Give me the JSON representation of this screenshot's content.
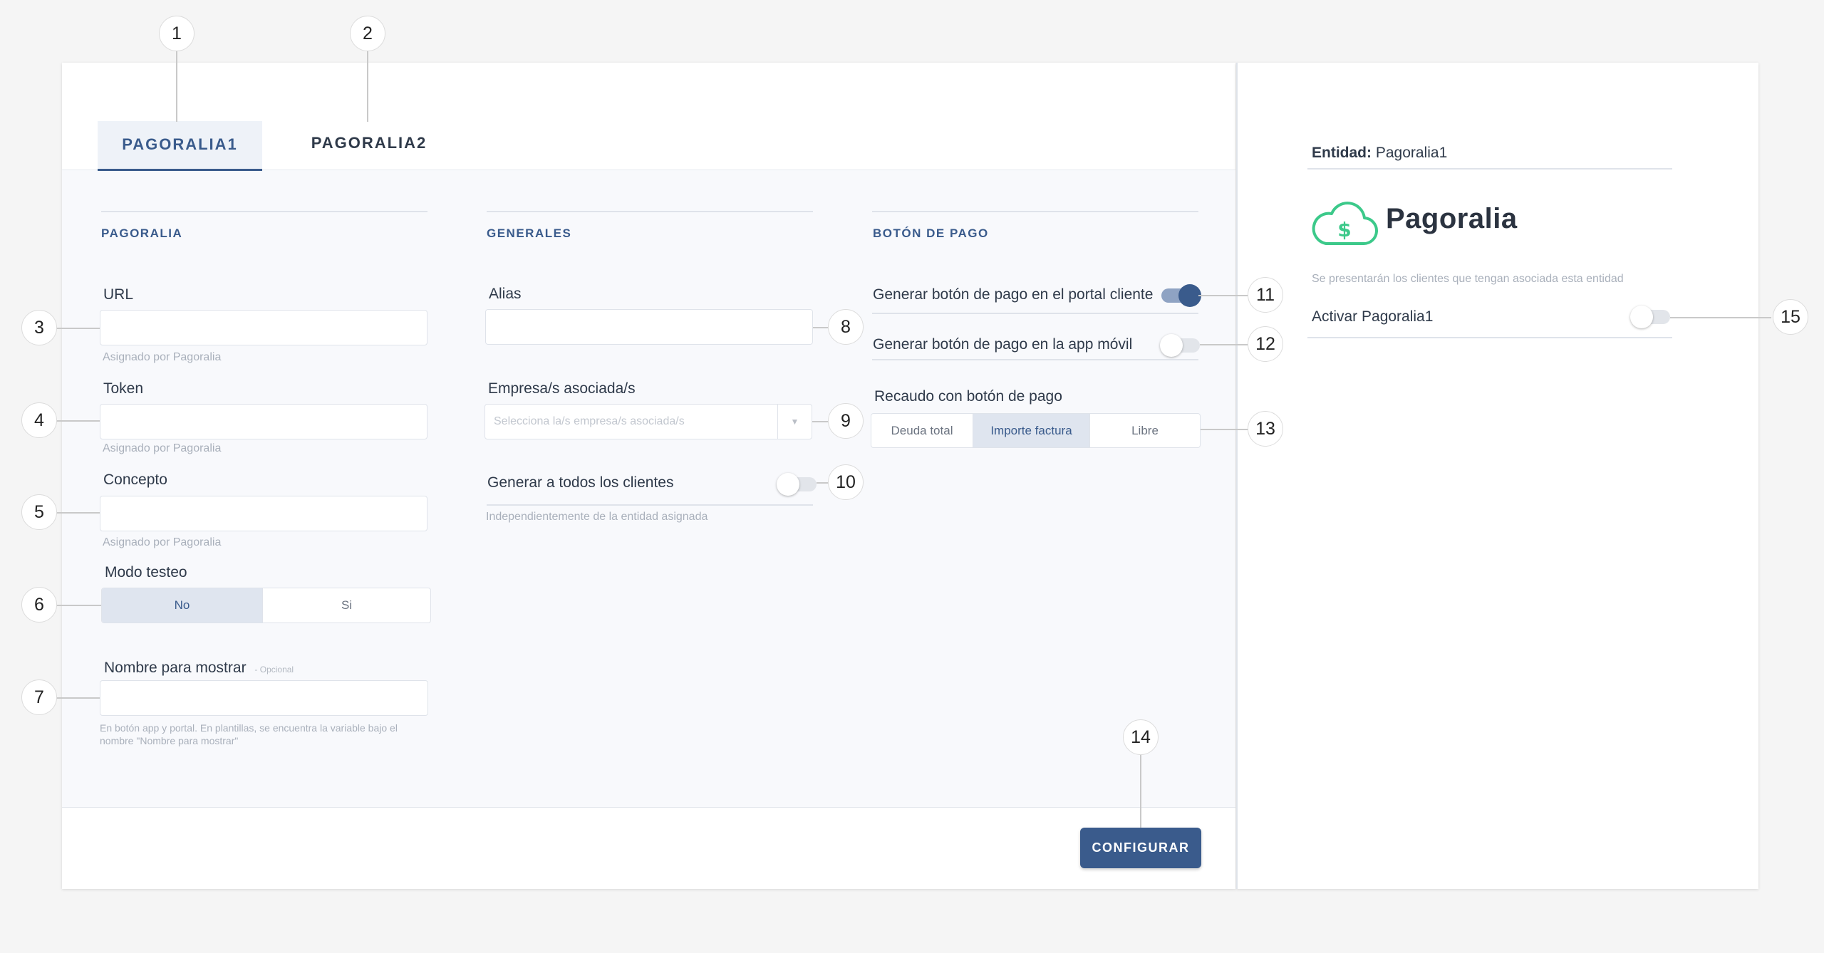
{
  "tabs": [
    {
      "label": "PAGORALIA1",
      "active": true
    },
    {
      "label": "PAGORALIA2",
      "active": false
    }
  ],
  "pagoralia": {
    "title": "PAGORALIA",
    "url_label": "URL",
    "url_hint": "Asignado por Pagoralia",
    "token_label": "Token",
    "token_hint": "Asignado por Pagoralia",
    "concepto_label": "Concepto",
    "concepto_hint": "Asignado por Pagoralia",
    "modo_label": "Modo testeo",
    "modo_options": [
      "No",
      "Si"
    ],
    "modo_selected": "No",
    "nombre_label": "Nombre para mostrar",
    "nombre_optional": "- Opcional",
    "nombre_hint_1": "En botón app y portal. En plantillas, se encuentra la variable bajo el",
    "nombre_hint_2": "nombre \"Nombre para mostrar\""
  },
  "generales": {
    "title": "GENERALES",
    "alias_label": "Alias",
    "empresa_label": "Empresa/s asociada/s",
    "empresa_placeholder": "Selecciona la/s empresa/s asociada/s",
    "generar_label": "Generar a todos los clientes",
    "generar_on": false,
    "generar_hint": "Independientemente de la entidad asignada"
  },
  "boton": {
    "title": "BOTÓN DE PAGO",
    "portal_label": "Generar botón de pago en el portal cliente",
    "portal_on": true,
    "app_label": "Generar botón de pago en la app móvil",
    "app_on": false,
    "recaudo_label": "Recaudo con botón de pago",
    "recaudo_options": [
      "Deuda total",
      "Importe factura",
      "Libre"
    ],
    "recaudo_selected": "Importe factura"
  },
  "footer": {
    "configurar_label": "CONFIGURAR"
  },
  "side": {
    "entidad_key": "Entidad:",
    "entidad_value": "Pagoralia1",
    "logo_text": "Pagoralia",
    "note": "Se presentarán los clientes que tengan asociada esta entidad",
    "activar_label": "Activar Pagoralia1",
    "activar_on": false
  },
  "callouts": [
    "1",
    "2",
    "3",
    "4",
    "5",
    "6",
    "7",
    "8",
    "9",
    "10",
    "11",
    "12",
    "13",
    "14",
    "15"
  ],
  "colors": {
    "accent": "#3a5b8c",
    "logo_green": "#3cc98a",
    "logo_text": "#2b3340"
  }
}
